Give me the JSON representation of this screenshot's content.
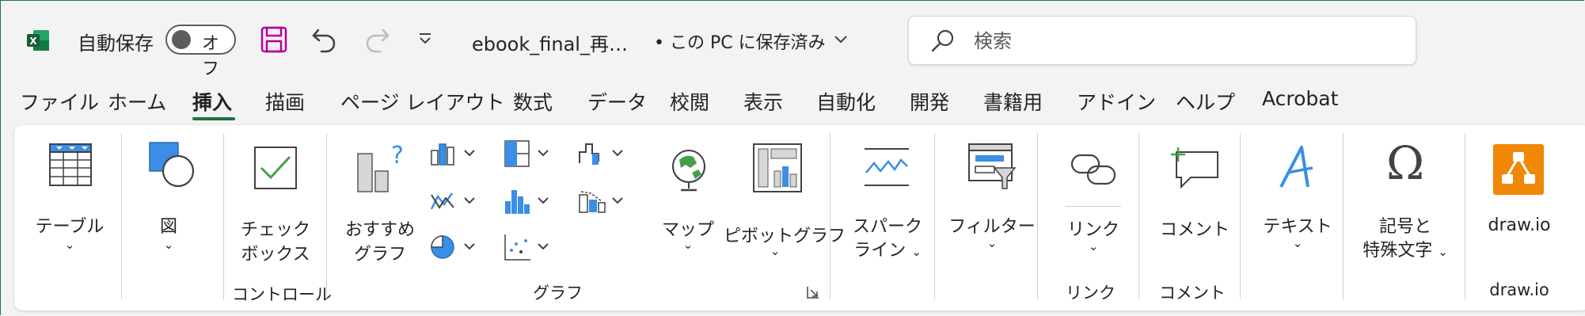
{
  "app": {
    "icon": "excel-icon",
    "autosave_label": "自動保存",
    "autosave_state": "オフ",
    "filename": "ebook_final_再…",
    "save_status": "• この PC に保存済み"
  },
  "search": {
    "placeholder": "検索"
  },
  "menu": {
    "tabs": [
      "ファイル",
      "ホーム",
      "挿入",
      "描画",
      "ページ レイアウト",
      "数式",
      "データ",
      "校閲",
      "表示",
      "自動化",
      "開発",
      "書籍用",
      "アドイン",
      "ヘルプ",
      "Acrobat"
    ],
    "active": "挿入"
  },
  "ribbon": {
    "table": "テーブル",
    "illustration": "図",
    "checkbox_line1": "チェック",
    "checkbox_line2": "ボックス",
    "recommended_line1": "おすすめ",
    "recommended_line2": "グラフ",
    "map": "マップ",
    "pivot": "ピボットグラフ",
    "sparkline_line1": "スパーク",
    "sparkline_line2": "ライン",
    "filter": "フィルター",
    "link": "リンク",
    "comment": "コメント",
    "text": "テキスト",
    "symbols_line1": "記号と",
    "symbols_line2": "特殊文字",
    "drawio": "draw.io",
    "groups": {
      "control": "コントロール",
      "chart": "グラフ",
      "link": "リンク",
      "comment": "コメント",
      "drawio": "draw.io"
    }
  },
  "colors": {
    "accent": "#1e7145",
    "blue": "#3a8ee6",
    "drawio": "#f08705",
    "green": "#43a047"
  }
}
